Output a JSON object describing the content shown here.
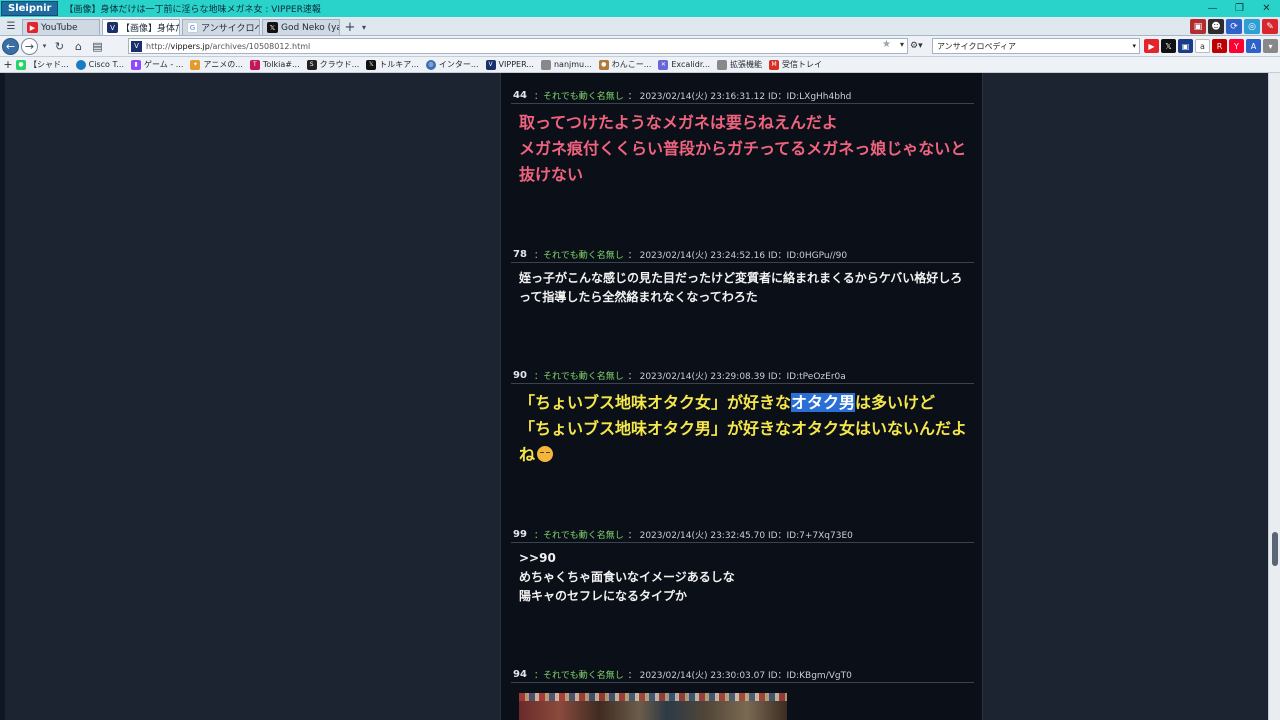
{
  "window": {
    "app_name": "Sleipnir",
    "title": "【画像】身体だけは一丁前に淫らな地味メガネ女 : VIPPER速報"
  },
  "tabs": [
    {
      "label": "YouTube",
      "icon": "youtube-icon",
      "color": "#e3242b"
    },
    {
      "label": "【画像】身体だけ...",
      "icon": "vipper-icon",
      "color": "#1a2f6b"
    },
    {
      "label": "アンサイクロペディ...",
      "icon": "google-icon",
      "color": "#4285f4"
    },
    {
      "label": "God Neko (yaye...",
      "icon": "x-icon",
      "color": "#111111"
    }
  ],
  "address": {
    "url_prefix": "http://",
    "url_domain": "vippers.jp",
    "url_path": "/archives/10508012.html",
    "search_value": "アンサイクロペディア"
  },
  "bookmarks": [
    {
      "label": "【シャド...",
      "icon": "whatsapp-icon",
      "color": "#25d366"
    },
    {
      "label": "Cisco T...",
      "icon": "cisco-icon",
      "color": "#1b7ac2"
    },
    {
      "label": "ゲーム - ...",
      "icon": "twitch-icon",
      "color": "#9146ff"
    },
    {
      "label": "アニメの...",
      "icon": "sparkle-icon",
      "color": "#e29b2d"
    },
    {
      "label": "Tolkia#...",
      "icon": "tolkia-icon",
      "color": "#c2185b"
    },
    {
      "label": "クラウド...",
      "icon": "sec-icon",
      "color": "#222222"
    },
    {
      "label": "トルキア...",
      "icon": "x-icon",
      "color": "#111111"
    },
    {
      "label": "インター...",
      "icon": "globe-icon",
      "color": "#3a6fb5"
    },
    {
      "label": "VIPPER...",
      "icon": "vipper-icon",
      "color": "#1a2f6b"
    },
    {
      "label": "nanjmu...",
      "icon": "page-icon",
      "color": "#888888"
    },
    {
      "label": "わんこー...",
      "icon": "dog-icon",
      "color": "#b07a3b"
    },
    {
      "label": "Excalidr...",
      "icon": "excalidraw-icon",
      "color": "#6965db"
    },
    {
      "label": "拡張機能",
      "icon": "page-icon",
      "color": "#888888"
    },
    {
      "label": "受信トレイ",
      "icon": "gmail-icon",
      "color": "#d93025"
    }
  ],
  "posts": [
    {
      "number": "44",
      "name": "：それでも動く名無し",
      "meta": "： 2023/02/14(火) 23:16:31.12 ID：ID:LXgHh4bhd",
      "body": "取ってつけたようなメガネは要らねえんだよ\nメガネ痕付くくらい普段からガチってるメガネっ娘じゃないと抜けない"
    },
    {
      "number": "78",
      "name": "：それでも動く名無し",
      "meta": "： 2023/02/14(火) 23:24:52.16 ID：ID:0HGPu//90",
      "body": "姪っ子がこんな感じの見た目だったけど変質者に絡まれまくるからケバい格好しろって指導したら全然絡まれなくなってわろた"
    },
    {
      "number": "90",
      "name": "：それでも動く名無し",
      "meta": "： 2023/02/14(火) 23:29:08.39 ID：ID:tPeOzEr0a",
      "body_pre": "「ちょいブス地味オタク女」が好きな",
      "body_hl": "オタク男",
      "body_post": "は多いけど\n「ちょいブス地味オタク男」が好きなオタク女はいないんだよね"
    },
    {
      "number": "99",
      "name": "：それでも動く名無し",
      "meta": "： 2023/02/14(火) 23:32:45.70 ID：ID:7+7Xq73E0",
      "body": ">>90\nめちゃくちゃ面食いなイメージあるしな\n陽キャのセフレになるタイプか"
    },
    {
      "number": "94",
      "name": "：それでも動く名無し",
      "meta": "： 2023/02/14(火) 23:30:03.07 ID：ID:KBgm/VgT0"
    }
  ]
}
